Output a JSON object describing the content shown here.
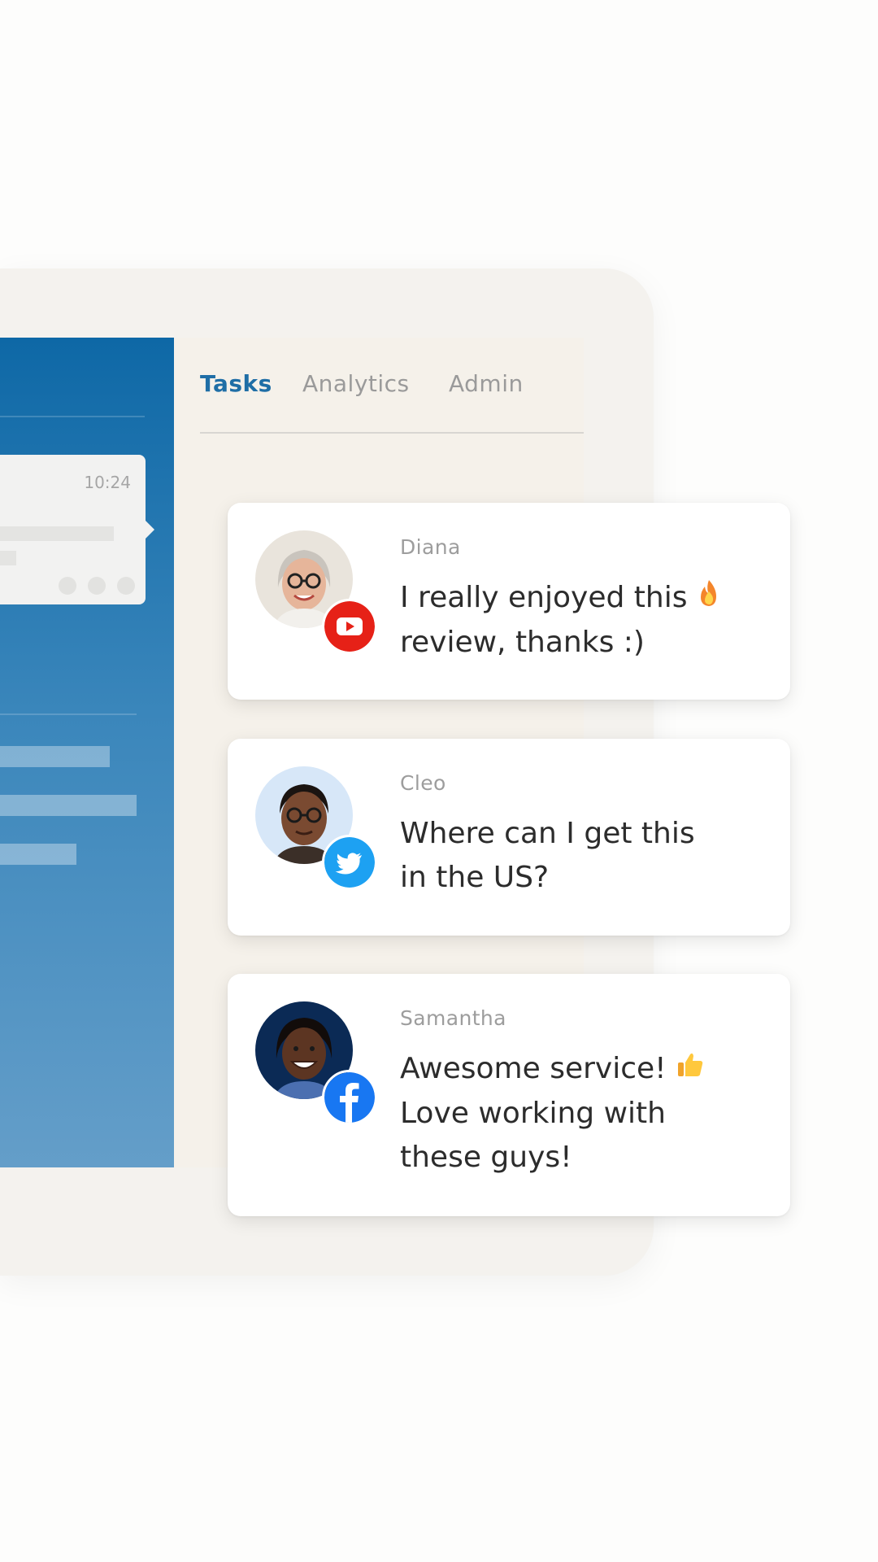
{
  "tabs": [
    {
      "label": "Tasks",
      "active": true
    },
    {
      "label": "Analytics",
      "active": false
    },
    {
      "label": "Admin",
      "active": false
    }
  ],
  "chat_preview": {
    "time": "10:24"
  },
  "comments": [
    {
      "name": "Diana",
      "platform": "youtube",
      "platform_icon": "youtube-icon",
      "platform_color": "#e62117",
      "avatar_bg": "#e9e4dc",
      "lines": [
        "I really enjoyed this",
        "review, thanks :)"
      ],
      "emoji": "fire-emoji"
    },
    {
      "name": "Cleo",
      "platform": "twitter",
      "platform_icon": "twitter-icon",
      "platform_color": "#1da1f2",
      "avatar_bg": "#d7e7f8",
      "lines": [
        "Where can I get this",
        "in the US?"
      ],
      "emoji": ""
    },
    {
      "name": "Samantha",
      "platform": "facebook",
      "platform_icon": "facebook-icon",
      "platform_color": "#1877f2",
      "avatar_bg": "#0b2a55",
      "lines": [
        "Awesome service!",
        "Love working with",
        "these guys!"
      ],
      "emoji": "thumbs-up-emoji"
    }
  ],
  "colors": {
    "sidebar_top": "#0e68a6",
    "sidebar_bottom": "#649ec9",
    "tab_active": "#1f6ea6",
    "tab_inactive": "#9a9a9a",
    "page_bg": "#fdfdfc",
    "device_bg": "#f4f2ee"
  }
}
